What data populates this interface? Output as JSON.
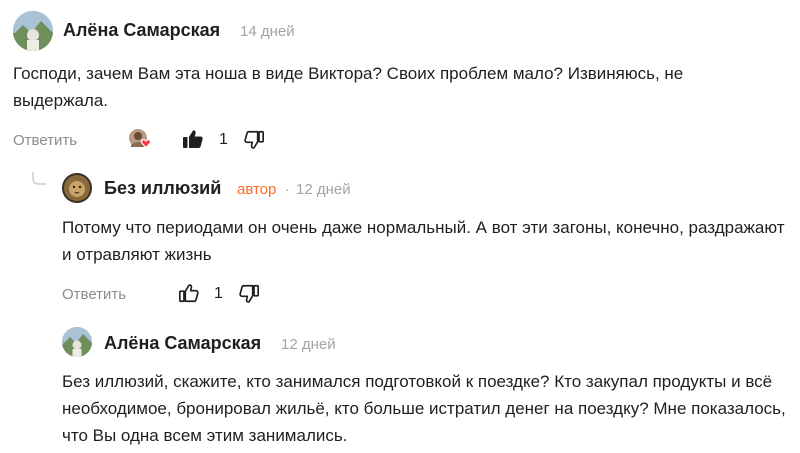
{
  "comments": [
    {
      "author": "Алёна Самарская",
      "date": "14 дней",
      "text": "Господи, зачем Вам эта ноша в виде Виктора? Своих проблем мало? Извиняюсь, не выдержала.",
      "reply_label": "Ответить",
      "likes": "1",
      "liked": true
    },
    {
      "author": "Без иллюзий",
      "badge": "автор",
      "separator": "·",
      "date": "12 дней",
      "text": "Потому что периодами он очень даже нормальный. А вот эти загоны, конечно, раздражают и отравляют жизнь",
      "reply_label": "Ответить",
      "likes": "1",
      "liked": false
    },
    {
      "author": "Алёна Самарская",
      "date": "12 дней",
      "text": "Без иллюзий, скажите, кто занимался подготовкой к поездке? Кто закупал продукты и всё необходимое, бронировал жильё, кто больше истратил денег на поездку? Мне показалось, что Вы одна всем этим занимались."
    }
  ],
  "colors": {
    "author_badge": "#ff6a2b",
    "muted": "#8c8c8c",
    "text": "#1f1f1f",
    "reaction_heart": "#ff3347"
  }
}
